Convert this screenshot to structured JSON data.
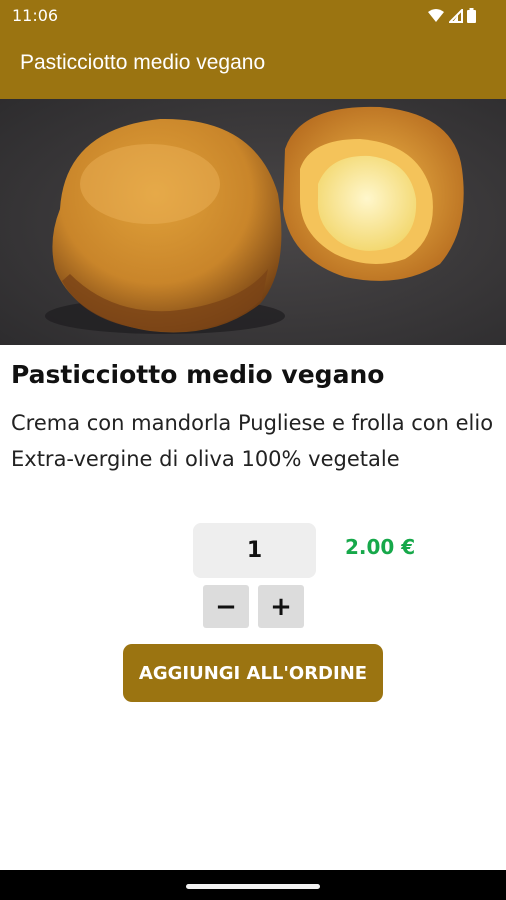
{
  "status_bar": {
    "time": "11:06",
    "icons": [
      "wifi-icon",
      "signal-icon",
      "battery-icon"
    ]
  },
  "app_bar": {
    "title": "Pasticciotto medio vegano",
    "color": "#9b7411"
  },
  "product": {
    "image_icon": "pastry-photo",
    "name": "Pasticciotto medio vegano",
    "description": "Crema con mandorla Pugliese e frolla con elio Extra-vergine di oliva 100% vegetale",
    "quantity": "1",
    "price": "2.00 €",
    "price_color": "#16a84a"
  },
  "stepper": {
    "minus_label": "−",
    "plus_label": "+"
  },
  "actions": {
    "add_label": "AGGIUNGI ALL'ORDINE"
  }
}
